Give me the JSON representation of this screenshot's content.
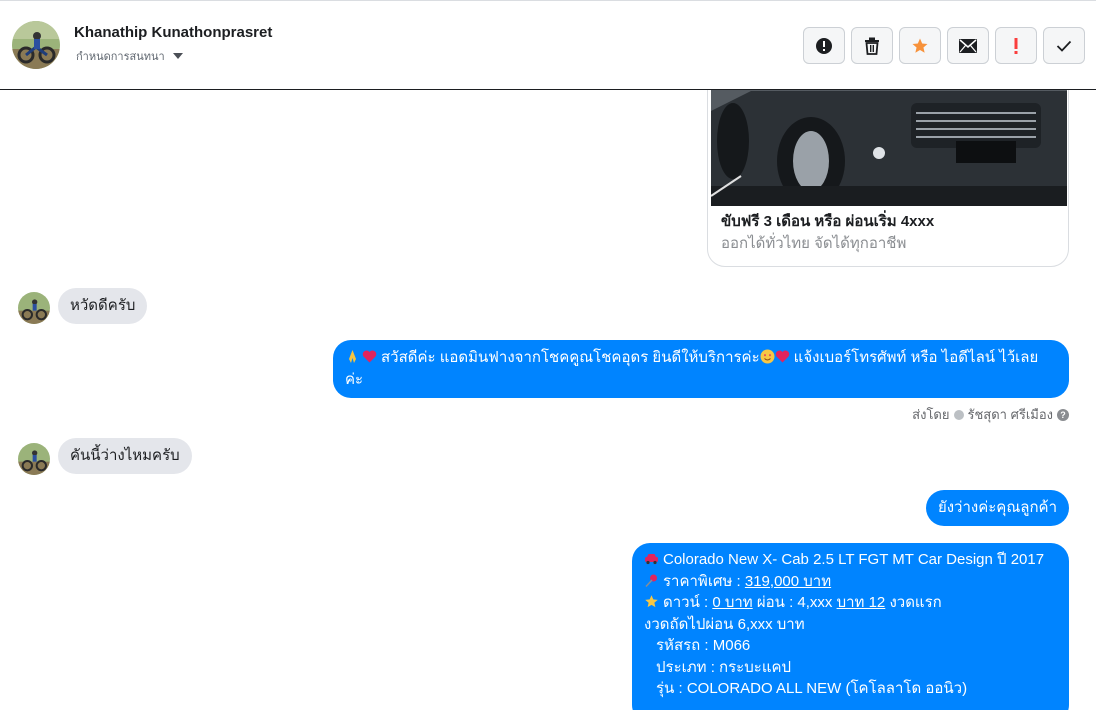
{
  "header": {
    "name": "Khanathip Kunathonprasret",
    "subtitle": "กำหนดการสนทนา"
  },
  "actions": [
    {
      "icon": "alert-circle-icon",
      "label": "Mark as spam"
    },
    {
      "icon": "trash-icon",
      "label": "Delete"
    },
    {
      "icon": "star-icon",
      "label": "Star",
      "color": "#f7923b"
    },
    {
      "icon": "envelope-icon",
      "label": "Mark unread"
    },
    {
      "icon": "exclamation-icon",
      "label": "Follow up",
      "color": "#fa3e3e"
    },
    {
      "icon": "check-icon",
      "label": "Done"
    }
  ],
  "card": {
    "title": "ขับฟรี 3 เดือน หรือ ผ่อนเริ่ม 4xxx",
    "subtitle": "ออกได้ทั่วไทย จัดได้ทุกอาชีพ"
  },
  "messages": {
    "in1": "หวัดดีครับ",
    "out1_line1": "สวัสดีค่ะ แอดมินฟางจากโชคคูณโชคอุดร ยินดีให้บริการค่ะ",
    "out1_line1b": "แจ้งเบอร์โทรศัพท์ หรือ ไอดีไลน์  ไว้เลย",
    "out1_line2": "ค่ะ",
    "in2": "คันนี้ว่างไหมครับ",
    "out2": "ยังว่างค่ะคุณลูกค้า"
  },
  "sent_by": {
    "prefix": "ส่งโดย",
    "name": "รัชสุดา ศรีเมือง",
    "help": "?"
  },
  "long_message": {
    "l1": "Colorado New X- Cab 2.5 LT FGT MT Car Design ปี 2017",
    "l2_label": "ราคาพิเศษ : ",
    "l2_value": "319,000 บาท",
    "l3_a": "ดาวน์ : ",
    "l3_b": "0 บาท",
    "l3_c": " ผ่อน : 4,xxx ",
    "l3_d": "บาท 12",
    "l3_e": " งวดแรก",
    "l4": "งวดถัดไปผ่อน  6,xxx  บาท",
    "l5": "รหัสรถ : M066",
    "l6": "ประเภท : กระบะแคป",
    "l7": "รุ่น : COLORADO ALL NEW (โคโลลาโด ออนิว)"
  },
  "colors": {
    "accent": "#0084ff",
    "incoming": "#e4e6eb"
  }
}
